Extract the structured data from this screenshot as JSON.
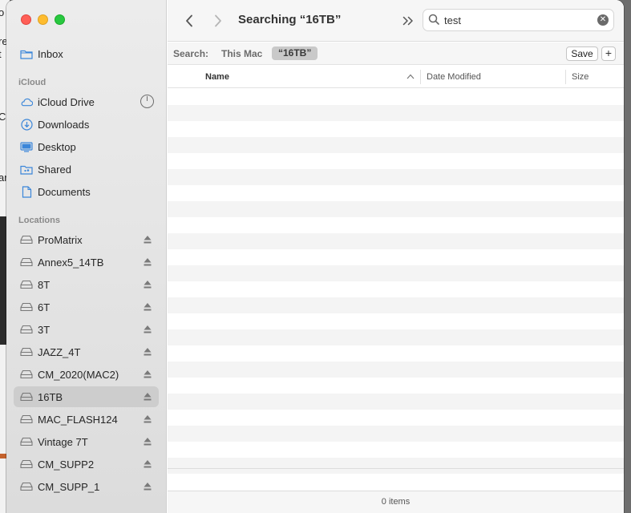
{
  "background_window": {
    "fragments": [
      "o",
      "re",
      "t",
      "C",
      "ar"
    ]
  },
  "sidebar": {
    "top_items": [
      {
        "label": "Inbox",
        "icon": "folder-icon"
      }
    ],
    "icloud": {
      "header": "iCloud",
      "items": [
        {
          "label": "iCloud Drive",
          "icon": "cloud-icon"
        },
        {
          "label": "Downloads",
          "icon": "download-icon"
        },
        {
          "label": "Desktop",
          "icon": "desktop-icon"
        },
        {
          "label": "Shared",
          "icon": "shared-folder-icon"
        },
        {
          "label": "Documents",
          "icon": "document-icon"
        }
      ]
    },
    "locations": {
      "header": "Locations",
      "items": [
        {
          "label": "ProMatrix",
          "icon": "drive-icon"
        },
        {
          "label": "Annex5_14TB",
          "icon": "drive-icon"
        },
        {
          "label": "8T",
          "icon": "drive-icon"
        },
        {
          "label": "6T",
          "icon": "drive-icon"
        },
        {
          "label": "3T",
          "icon": "drive-icon"
        },
        {
          "label": "JAZZ_4T",
          "icon": "drive-icon"
        },
        {
          "label": "CM_2020(MAC2)",
          "icon": "drive-icon"
        },
        {
          "label": "16TB",
          "icon": "drive-icon",
          "selected": true
        },
        {
          "label": "MAC_FLASH124",
          "icon": "drive-icon"
        },
        {
          "label": "Vintage 7T",
          "icon": "drive-icon"
        },
        {
          "label": "CM_SUPP2",
          "icon": "drive-icon"
        },
        {
          "label": "CM_SUPP_1",
          "icon": "drive-icon"
        }
      ]
    }
  },
  "toolbar": {
    "title": "Searching “16TB”",
    "search_value": "test"
  },
  "scope_bar": {
    "label": "Search:",
    "option_mac": "This Mac",
    "option_selected": "“16TB”",
    "save_label": "Save",
    "plus_label": "+"
  },
  "columns": {
    "name": "Name",
    "date_modified": "Date Modified",
    "size": "Size"
  },
  "status_bar": {
    "text": "0 items"
  },
  "colors": {
    "close": "#ff5f57",
    "minimize": "#febc2e",
    "maximize": "#28c840",
    "icon_blue": "#3b86d9",
    "selection": "#cdcdcd"
  }
}
